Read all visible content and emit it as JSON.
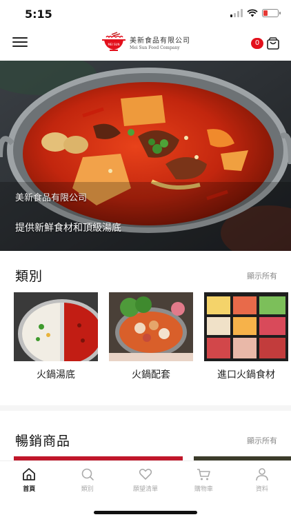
{
  "status_bar": {
    "time": "5:15"
  },
  "header": {
    "company_name": "美新食品有限公司",
    "company_name_en": "Mei Sun Food Company",
    "cart_count": "0"
  },
  "hero": {
    "company": "美新食品有限公司",
    "slogan": "提供新鮮食材和頂級湯底"
  },
  "categories_section": {
    "title": "類別",
    "see_all": "顯示所有",
    "items": [
      {
        "label": "火鍋湯底"
      },
      {
        "label": "火鍋配套"
      },
      {
        "label": "進口火鍋食材"
      }
    ]
  },
  "bestsellers_section": {
    "title": "暢銷商品",
    "see_all": "顯示所有"
  },
  "tab_bar": {
    "tabs": [
      {
        "label": "首頁",
        "icon": "home-icon",
        "active": true
      },
      {
        "label": "類別",
        "icon": "search-icon",
        "active": false
      },
      {
        "label": "願望清單",
        "icon": "heart-icon",
        "active": false
      },
      {
        "label": "購物車",
        "icon": "cart-icon",
        "active": false
      },
      {
        "label": "資料",
        "icon": "user-icon",
        "active": false
      }
    ]
  },
  "colors": {
    "accent": "#e3101c",
    "tab_active": "#222222",
    "tab_inactive": "#aaaaaa"
  }
}
